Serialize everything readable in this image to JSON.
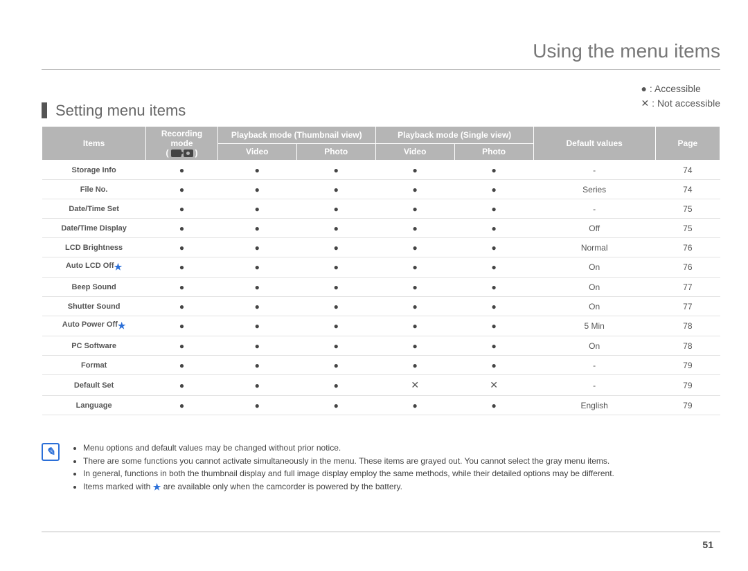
{
  "pageTitle": "Using the menu items",
  "sectionTitle": "Setting menu items",
  "legend": {
    "accessible": "● : Accessible",
    "notAccessible": "✕ : Not accessible"
  },
  "headers": {
    "items": "Items",
    "recordingMode": "Recording mode",
    "thumbnail": "Playback mode (Thumbnail view)",
    "single": "Playback mode (Single view)",
    "video": "Video",
    "photo": "Photo",
    "defaultValues": "Default values",
    "page": "Page"
  },
  "chart_data": {
    "type": "table",
    "columns": [
      "Items",
      "Recording mode",
      "Thumbnail Video",
      "Thumbnail Photo",
      "Single Video",
      "Single Photo",
      "Default values",
      "Page"
    ],
    "legend": {
      "dot": "Accessible",
      "x": "Not accessible",
      "star": "battery-only item"
    },
    "rows": [
      {
        "name": "Storage Info",
        "star": false,
        "cells": [
          "dot",
          "dot",
          "dot",
          "dot",
          "dot"
        ],
        "default": "-",
        "page": "74"
      },
      {
        "name": "File No.",
        "star": false,
        "cells": [
          "dot",
          "dot",
          "dot",
          "dot",
          "dot"
        ],
        "default": "Series",
        "page": "74"
      },
      {
        "name": "Date/Time Set",
        "star": false,
        "cells": [
          "dot",
          "dot",
          "dot",
          "dot",
          "dot"
        ],
        "default": "-",
        "page": "75"
      },
      {
        "name": "Date/Time Display",
        "star": false,
        "cells": [
          "dot",
          "dot",
          "dot",
          "dot",
          "dot"
        ],
        "default": "Off",
        "page": "75"
      },
      {
        "name": "LCD Brightness",
        "star": false,
        "cells": [
          "dot",
          "dot",
          "dot",
          "dot",
          "dot"
        ],
        "default": "Normal",
        "page": "76"
      },
      {
        "name": "Auto LCD Off",
        "star": true,
        "cells": [
          "dot",
          "dot",
          "dot",
          "dot",
          "dot"
        ],
        "default": "On",
        "page": "76"
      },
      {
        "name": "Beep Sound",
        "star": false,
        "cells": [
          "dot",
          "dot",
          "dot",
          "dot",
          "dot"
        ],
        "default": "On",
        "page": "77"
      },
      {
        "name": "Shutter Sound",
        "star": false,
        "cells": [
          "dot",
          "dot",
          "dot",
          "dot",
          "dot"
        ],
        "default": "On",
        "page": "77"
      },
      {
        "name": "Auto Power Off",
        "star": true,
        "cells": [
          "dot",
          "dot",
          "dot",
          "dot",
          "dot"
        ],
        "default": "5 Min",
        "page": "78"
      },
      {
        "name": "PC Software",
        "star": false,
        "cells": [
          "dot",
          "dot",
          "dot",
          "dot",
          "dot"
        ],
        "default": "On",
        "page": "78"
      },
      {
        "name": "Format",
        "star": false,
        "cells": [
          "dot",
          "dot",
          "dot",
          "dot",
          "dot"
        ],
        "default": "-",
        "page": "79"
      },
      {
        "name": "Default Set",
        "star": false,
        "cells": [
          "dot",
          "dot",
          "dot",
          "x",
          "x"
        ],
        "default": "-",
        "page": "79"
      },
      {
        "name": "Language",
        "star": false,
        "cells": [
          "dot",
          "dot",
          "dot",
          "dot",
          "dot"
        ],
        "default": "English",
        "page": "79"
      }
    ]
  },
  "notes": [
    "Menu options and default values may be changed without prior notice.",
    "There are some functions you cannot activate simultaneously in the menu. These items are grayed out. You cannot select the gray menu items.",
    "In general, functions in both the thumbnail display and full image display employ the same methods, while their detailed options may be different.",
    "Items marked with ★ are available only when the camcorder is powered by the battery."
  ],
  "pageNumber": "51"
}
